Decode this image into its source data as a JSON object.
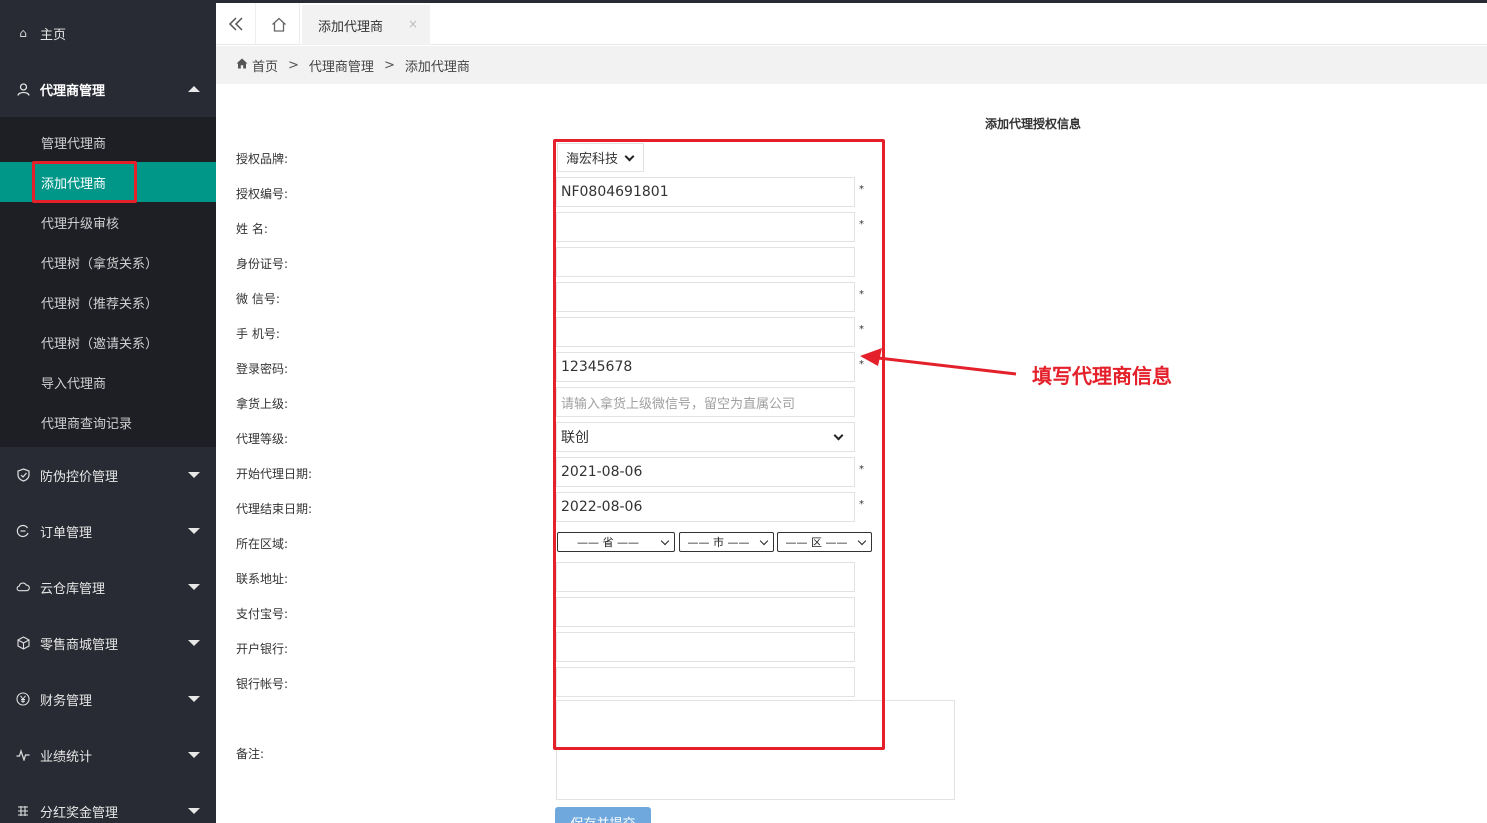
{
  "sidebar": {
    "home": "主页",
    "agent_mgmt": "代理商管理",
    "sub_items": [
      "管理代理商",
      "添加代理商",
      "代理升级审核",
      "代理树（拿货关系）",
      "代理树（推荐关系）",
      "代理树（邀请关系）",
      "导入代理商",
      "代理商查询记录"
    ],
    "active_sub": "添加代理商",
    "menus": [
      "防伪控价管理",
      "订单管理",
      "云仓库管理",
      "零售商城管理",
      "财务管理",
      "业绩统计",
      "分红奖金管理"
    ],
    "colors": {
      "bg": "#282b33",
      "submenu_bg": "#1d1f25",
      "active": "#009688"
    }
  },
  "tabs": {
    "active_tab": "添加代理商",
    "close": "×"
  },
  "breadcrumb": [
    "首页",
    "代理商管理",
    "添加代理商"
  ],
  "form": {
    "title": "添加代理授权信息",
    "labels": {
      "brand": "授权品牌:",
      "auth_no": "授权编号:",
      "name": "姓 名:",
      "id_card": "身份证号:",
      "wechat": "微 信号:",
      "phone": "手 机号:",
      "password": "登录密码:",
      "upline": "拿货上级:",
      "level": "代理等级:",
      "start_date": "开始代理日期:",
      "end_date": "代理结束日期:",
      "region": "所在区域:",
      "address": "联系地址:",
      "alipay": "支付宝号:",
      "bank": "开户银行:",
      "bank_account": "银行帐号:",
      "remark": "备注:"
    },
    "values": {
      "brand": "海宏科技",
      "auth_no": "NF0804691801",
      "password": "12345678",
      "upline_placeholder": "请输入拿货上级微信号，留空为直属公司",
      "level": "联创",
      "start_date": "2021-08-06",
      "end_date": "2022-08-06",
      "province": "—— 省 ——",
      "city": "—— 市 ——",
      "district": "—— 区 ——"
    },
    "required_mark": "*",
    "submit": "保存并提交"
  },
  "annotation": {
    "text": "填写代理商信息",
    "color": "#e4202a"
  }
}
